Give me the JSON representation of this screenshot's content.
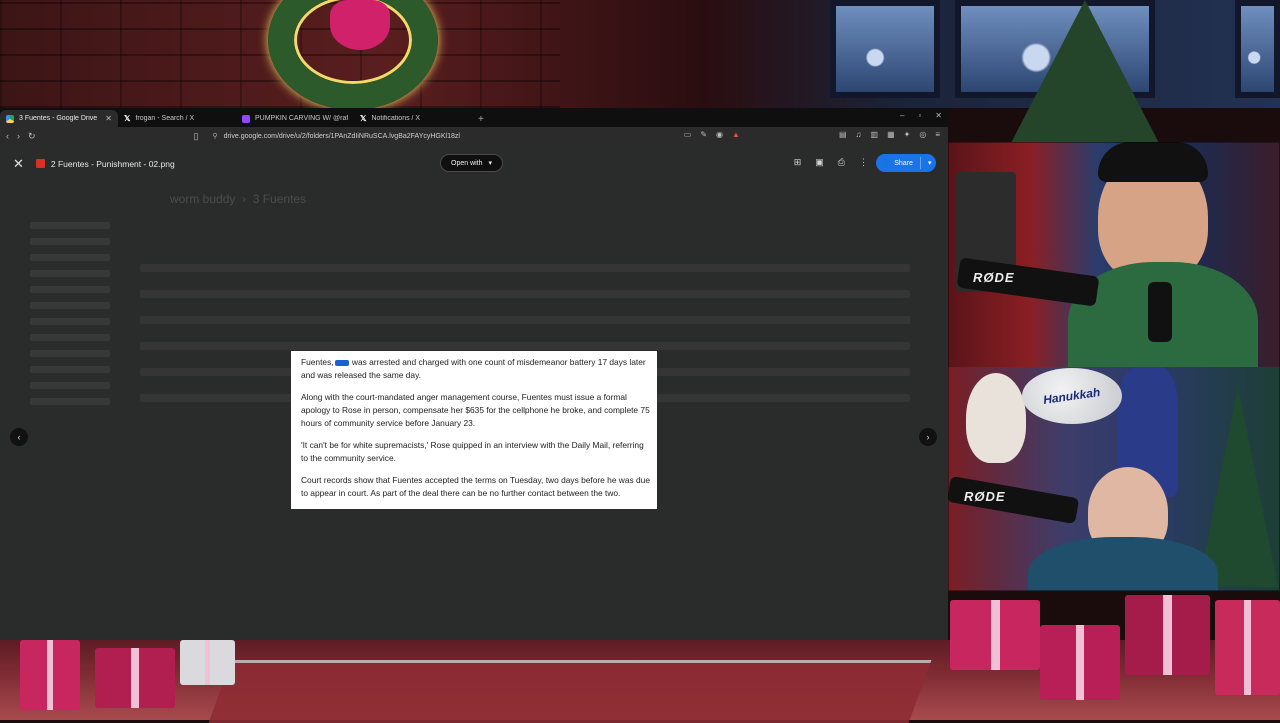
{
  "browser": {
    "tabs": [
      {
        "label": "3 Fuentes - Google Drive",
        "favicon": "google-drive-icon",
        "active": true
      },
      {
        "label": "frogan - Search / X",
        "favicon": "x-icon",
        "active": false
      },
      {
        "label": "PUMPKIN CARVING W/ @raffoultic",
        "favicon": "twitch-icon",
        "active": false
      },
      {
        "label": "Notifications / X",
        "favicon": "x-icon",
        "active": false
      }
    ],
    "url": "drive.google.com/drive/u/2/folders/1PAnZdIiNRuSCA.lvgBa2FAYcyHGKl18zl"
  },
  "viewer": {
    "file_name": "2 Fuentes - Punishment - 02.png",
    "open_with_label": "Open with",
    "share_label": "Share",
    "share_color": "#1a73e8"
  },
  "background_folder": {
    "breadcrumb_1": "worm buddy",
    "breadcrumb_2": "3 Fuentes"
  },
  "document": {
    "p1_a": "Fuentes,",
    "p1_b": "was arrested and charged with one count of misdemeanor battery 17 days later and was released the same day.",
    "p2": "Along with the court-mandated anger management course, Fuentes must issue a formal apology to Rose in person, compensate her $635 for the cellphone he broke, and complete 75 hours of community service before January 23.",
    "p3": "'It can't be for white supremacists,' Rose quipped in an interview with the Daily Mail, referring to the community service.",
    "p4": "Court records show that Fuentes accepted the terms on Tuesday, two days before he was due to appear in court.  As part of the deal there can be no further contact between the two.",
    "redaction_color": "#1d5fd1"
  },
  "stream": {
    "mic_label_1": "RØDE",
    "mic_label_2": "RØDE",
    "balloon_text": "Hanukkah"
  }
}
